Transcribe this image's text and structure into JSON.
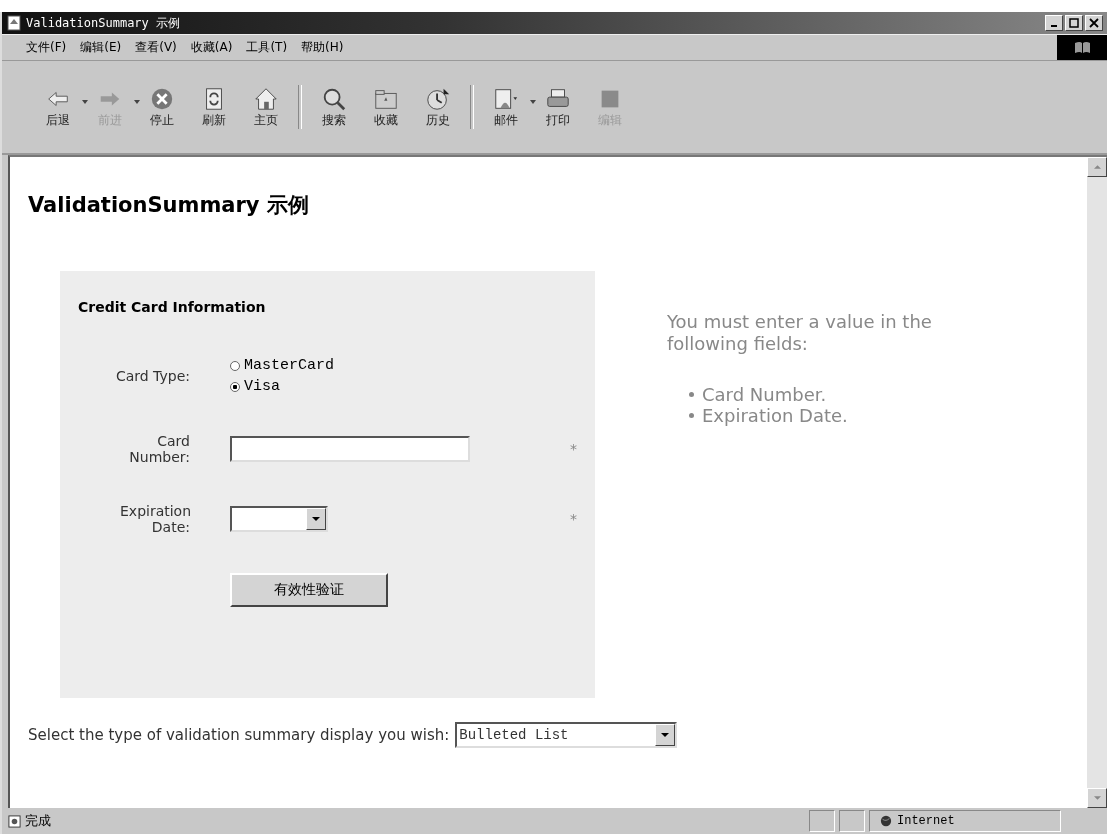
{
  "window": {
    "title": "ValidationSummary 示例"
  },
  "menu": [
    "文件(F)",
    "编辑(E)",
    "查看(V)",
    "收藏(A)",
    "工具(T)",
    "帮助(H)"
  ],
  "toolbar": [
    {
      "kind": "back",
      "label": "后退",
      "disabled": false,
      "dropdown": true
    },
    {
      "kind": "forward",
      "label": "前进",
      "disabled": true,
      "dropdown": true
    },
    {
      "kind": "stop",
      "label": "停止",
      "disabled": false,
      "dropdown": false
    },
    {
      "kind": "refresh",
      "label": "刷新",
      "disabled": false,
      "dropdown": false
    },
    {
      "kind": "home",
      "label": "主页",
      "disabled": false,
      "dropdown": false
    },
    {
      "kind": "search",
      "label": "搜索",
      "disabled": false,
      "dropdown": false
    },
    {
      "kind": "favorites",
      "label": "收藏",
      "disabled": false,
      "dropdown": false
    },
    {
      "kind": "history",
      "label": "历史",
      "disabled": false,
      "dropdown": false
    },
    {
      "kind": "mail",
      "label": "邮件",
      "disabled": false,
      "dropdown": true
    },
    {
      "kind": "print",
      "label": "打印",
      "disabled": false,
      "dropdown": false
    },
    {
      "kind": "edit",
      "label": "编辑",
      "disabled": true,
      "dropdown": false
    }
  ],
  "page": {
    "heading": "ValidationSummary 示例",
    "form": {
      "title": "Credit Card Information",
      "card_type_label": "Card Type:",
      "card_types": [
        {
          "label": "MasterCard",
          "selected": false
        },
        {
          "label": "Visa",
          "selected": true
        }
      ],
      "card_number_label": "Card Number:",
      "card_number_mark": "*",
      "expiration_label": "Expiration Date:",
      "expiration_mark": "*",
      "submit": "有效性验证"
    },
    "summary": {
      "header": "You must enter a value in the following fields:",
      "items": [
        "Card Number.",
        "Expiration Date."
      ]
    },
    "display_label": "Select the type of validation summary display you wish:",
    "display_value": "Bulleted List"
  },
  "status_bar": {
    "text": "完成",
    "zone": "Internet"
  }
}
